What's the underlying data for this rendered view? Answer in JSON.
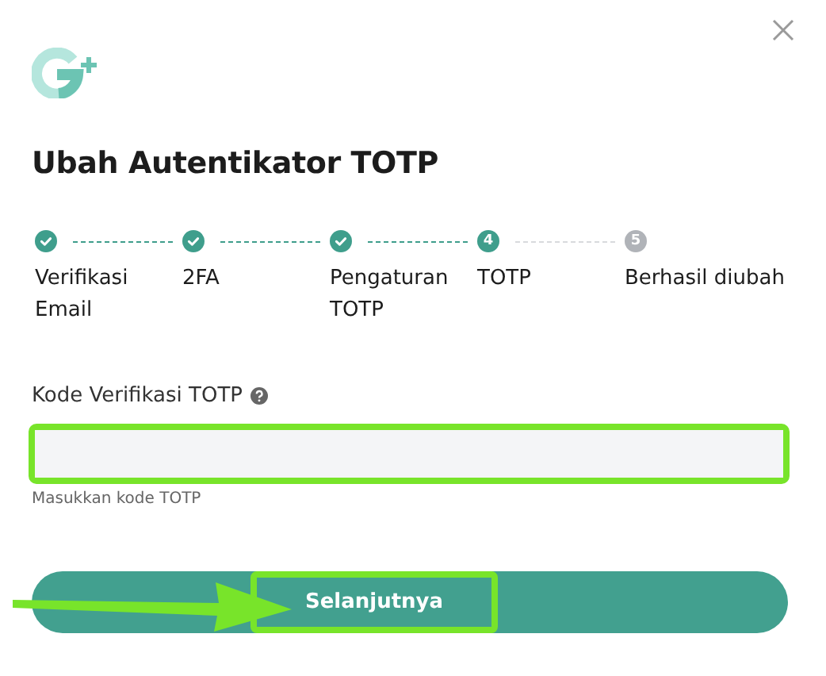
{
  "title": "Ubah Autentikator TOTP",
  "steps": [
    {
      "label": "Verifikasi Email",
      "completed": true,
      "current": false
    },
    {
      "label": "2FA",
      "completed": true,
      "current": false
    },
    {
      "label": "Pengaturan TOTP",
      "completed": true,
      "current": false
    },
    {
      "number": "4",
      "label": "TOTP",
      "completed": false,
      "current": true
    },
    {
      "number": "5",
      "label": "Berhasil diubah",
      "completed": false,
      "current": false
    }
  ],
  "field": {
    "label": "Kode Verifikasi TOTP",
    "help": "Masukkan kode TOTP",
    "highlighted": true
  },
  "button": {
    "label": "Selanjutnya",
    "highlighted": true,
    "arrow": true
  }
}
